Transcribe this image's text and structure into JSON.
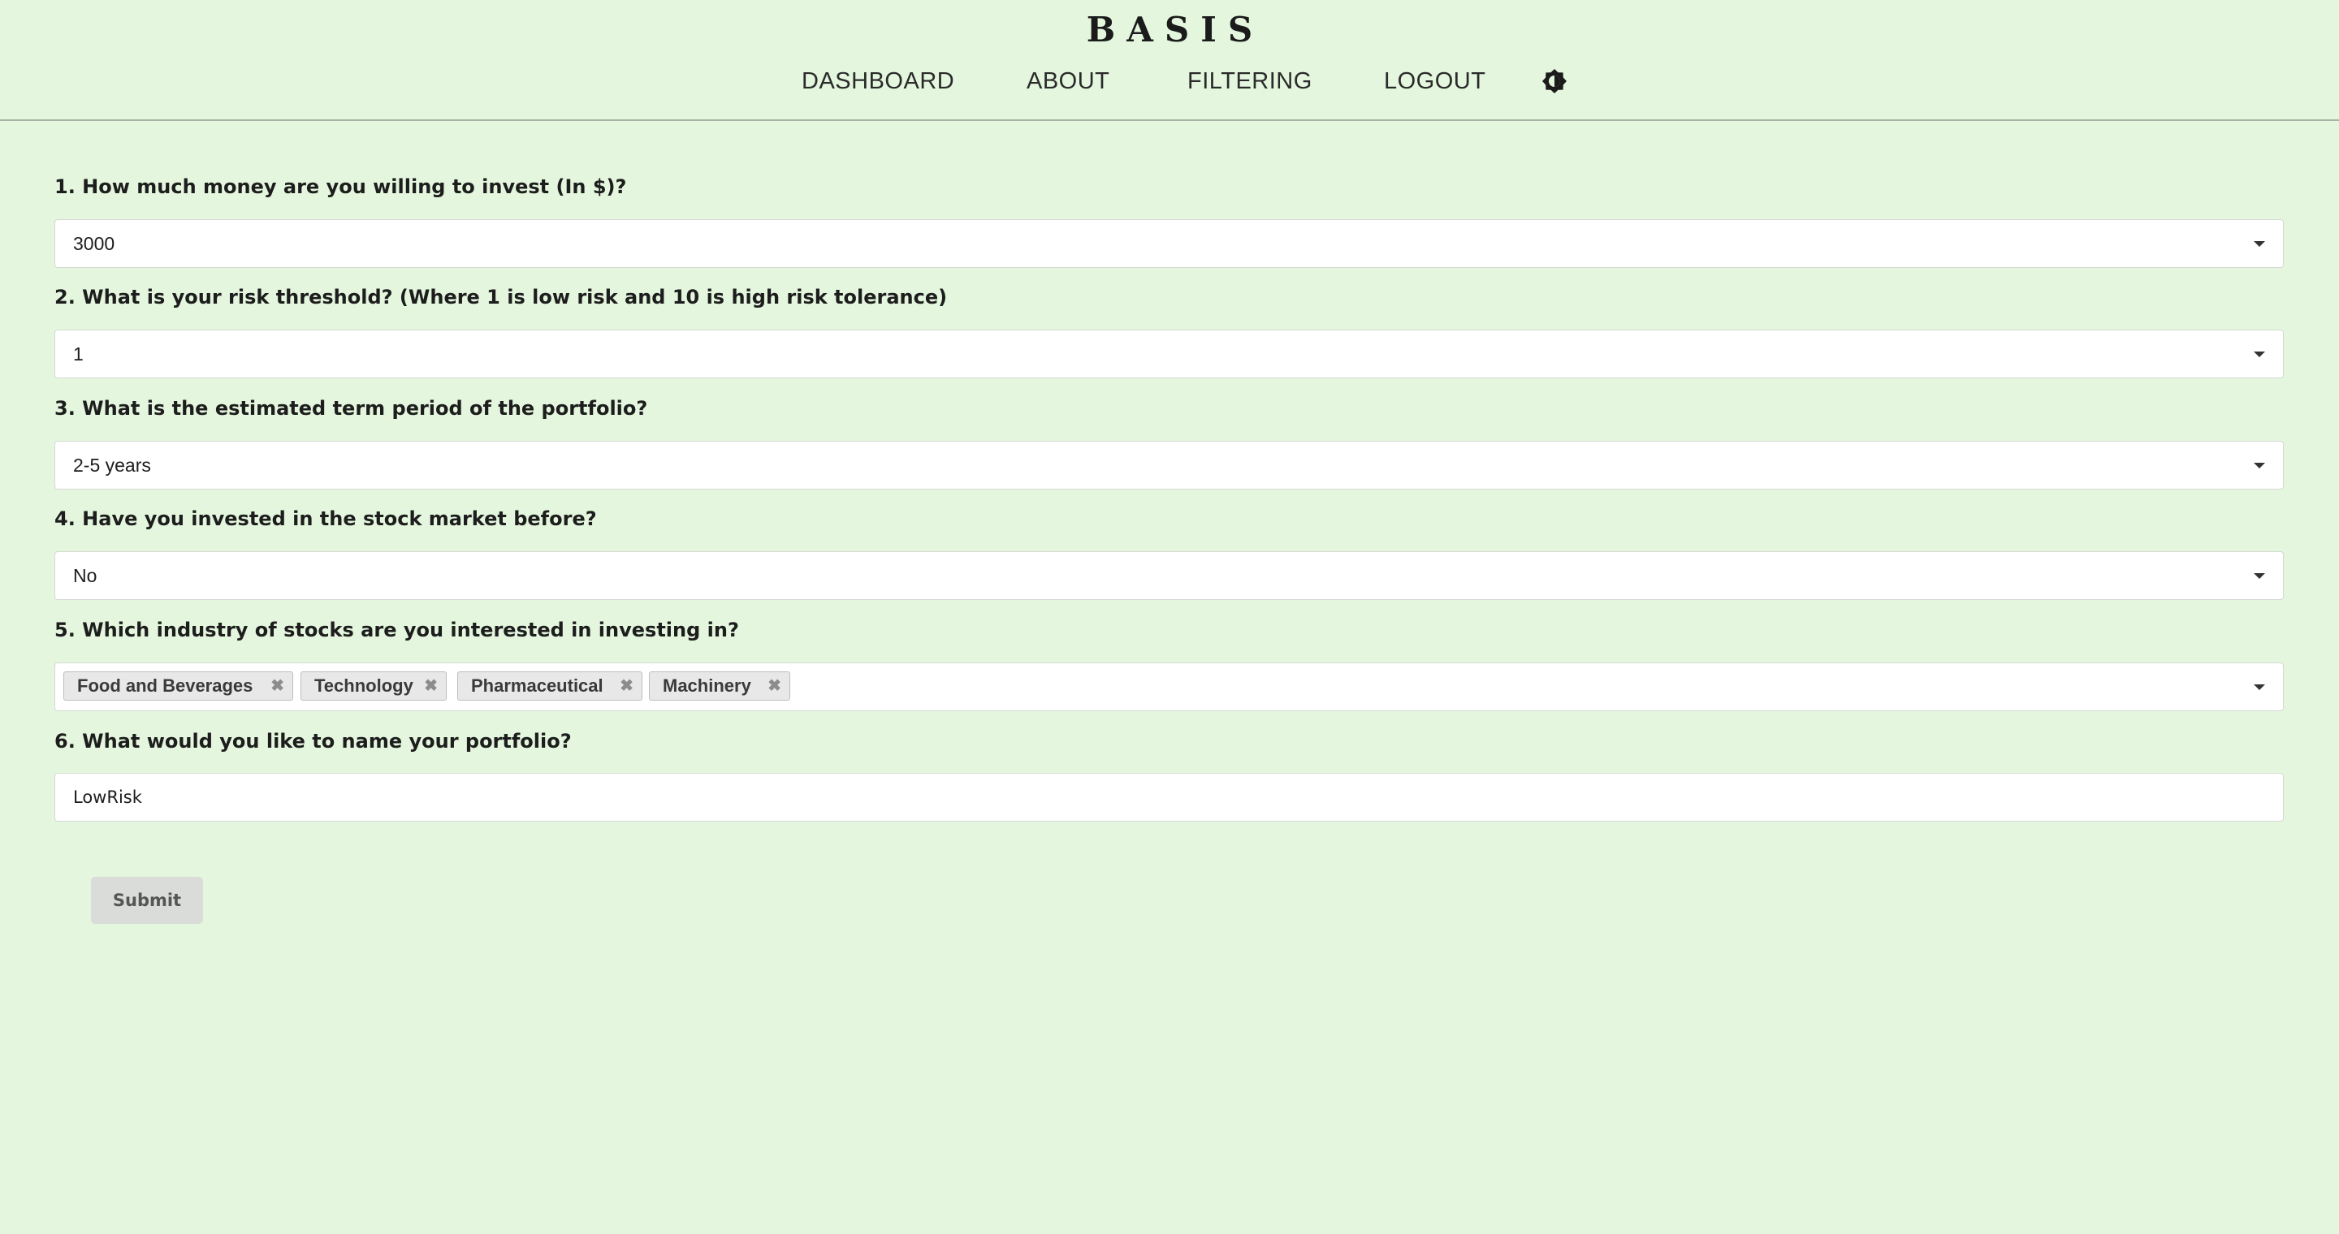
{
  "header": {
    "logo": "BASIS",
    "nav": [
      {
        "label": "DASHBOARD"
      },
      {
        "label": "ABOUT"
      },
      {
        "label": "FILTERING"
      },
      {
        "label": "LOGOUT"
      }
    ],
    "theme_toggle_icon": "brightness-icon"
  },
  "form": {
    "questions": [
      {
        "label": "1. How much money are you willing to invest (In $)?",
        "value": "3000"
      },
      {
        "label": "2. What is your risk threshold? (Where 1 is low risk and 10 is high risk tolerance)",
        "value": "1"
      },
      {
        "label": "3. What is the estimated term period of the portfolio?",
        "value": "2-5 years"
      },
      {
        "label": "4. Have you invested in the stock market before?",
        "value": "No"
      },
      {
        "label": "5. Which industry of stocks are you interested in investing in?",
        "tags": [
          "Food and Beverages",
          "Technology",
          "Pharmaceutical",
          "Machinery"
        ]
      },
      {
        "label": "6. What would you like to name your portfolio?",
        "value": "LowRisk"
      }
    ],
    "submit_label": "Submit"
  },
  "colors": {
    "background": "#e4f7de",
    "field_background": "#ffffff",
    "tag_background": "#e8e8e8",
    "submit_background": "#d9dcd8"
  }
}
